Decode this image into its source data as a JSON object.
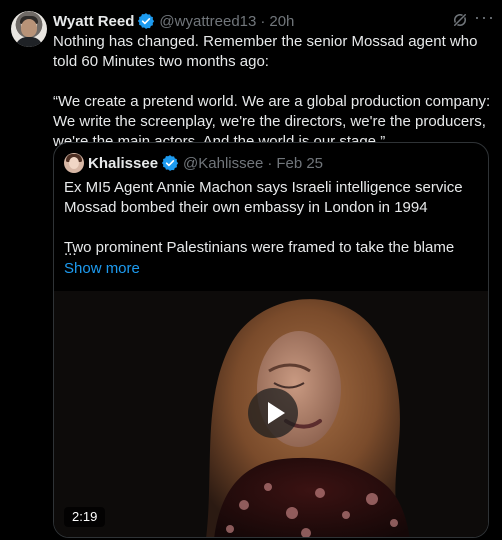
{
  "tweet": {
    "author_name": "Wyatt Reed",
    "author_handle": "@wyattreed13",
    "separator": "·",
    "time": "20h",
    "text_paragraphs": [
      "Nothing has changed. Remember the senior Mossad agent who told 60 Minutes two months ago:",
      "“We create a pretend world. We are a global production company: We write the screenplay, we're the directors, we're the producers, we're the main actors. And the world is our stage.”"
    ],
    "more_icon": "ellipsis-icon",
    "grok_icon": "grok-icon"
  },
  "quote": {
    "author_name": "Khalissee",
    "author_handle": "@Kahlissee",
    "separator": "·",
    "time": "Feb 25",
    "text_paragraphs": [
      "Ex MI5 Agent Annie Machon says Israeli intelligence service Mossad bombed their own embassy in London in 1994",
      "Two prominent Palestinians were framed to take the blame"
    ],
    "ellipsis": "...",
    "show_more": "Show more",
    "video": {
      "duration": "2:19",
      "play_icon": "play-icon"
    }
  },
  "colors": {
    "background": "#000000",
    "text": "#e7e9ea",
    "muted": "#71767b",
    "accent": "#1d9bf0",
    "border": "#2f3336"
  }
}
